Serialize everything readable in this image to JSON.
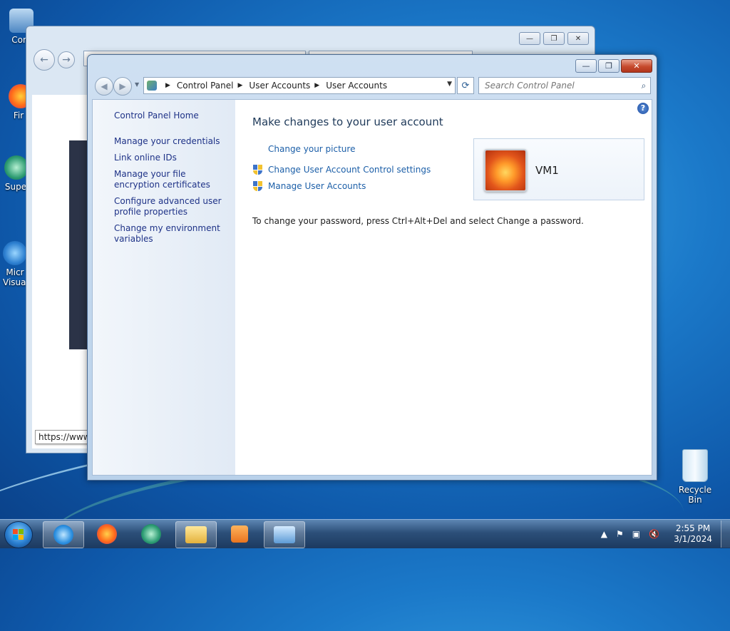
{
  "desktop": {
    "icons": [
      {
        "label": "Com"
      },
      {
        "label": "Fir"
      },
      {
        "label": "Supe"
      },
      {
        "label": "Micr Visual"
      }
    ],
    "recycle_bin_label": "Recycle Bin"
  },
  "background_window": {
    "status_url": "https://www"
  },
  "window": {
    "caption_buttons": {
      "minimize": "—",
      "maximize": "❐",
      "close": "✕"
    },
    "breadcrumbs": [
      "Control Panel",
      "User Accounts",
      "User Accounts"
    ],
    "search_placeholder": "Search Control Panel",
    "sidebar": {
      "home": "Control Panel Home",
      "links": [
        "Manage your credentials",
        "Link online IDs",
        "Manage your file encryption certificates",
        "Configure advanced user profile properties",
        "Change my environment variables"
      ]
    },
    "main": {
      "heading": "Make changes to your user account",
      "links": {
        "change_picture": "Change your picture",
        "uac_settings": "Change User Account Control settings",
        "manage_accounts": "Manage User Accounts"
      },
      "password_note": "To change your password, press Ctrl+Alt+Del and select Change a password.",
      "user_name": "VM1"
    }
  },
  "taskbar": {
    "time": "2:55 PM",
    "date": "3/1/2024"
  }
}
